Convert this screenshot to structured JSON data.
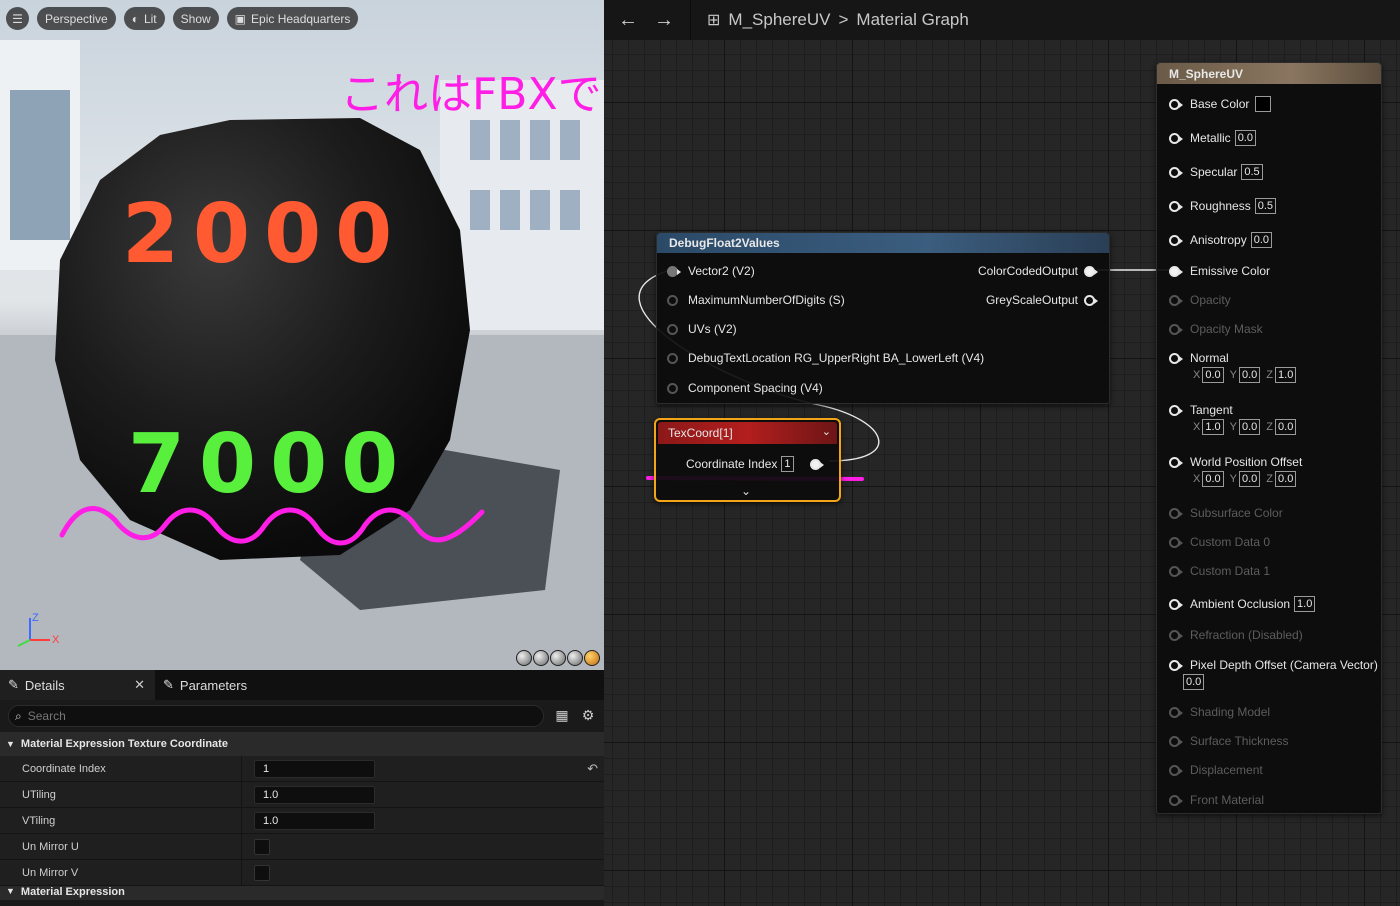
{
  "viewport": {
    "toolbar": {
      "menu_icon": "hamburger-icon",
      "perspective": "Perspective",
      "lit": "Lit",
      "show": "Show",
      "level": "Epic Headquarters"
    },
    "overlay_text": "これはFBXで書き出したモデル",
    "overlay_color": "#ff1ee6",
    "sphere_top_text": "2000",
    "sphere_top_color": "#ff5a32",
    "sphere_bottom_text": "7000",
    "sphere_bottom_color": "#58f03c",
    "axis_z": "Z",
    "axis_x": "X"
  },
  "details": {
    "tabs": [
      {
        "label": "Details",
        "icon": "pencil-icon"
      },
      {
        "label": "Parameters",
        "icon": "pencil-icon"
      }
    ],
    "search_placeholder": "Search",
    "category": "Material Expression Texture Coordinate",
    "properties": [
      {
        "name": "Coordinate Index",
        "value": "1"
      },
      {
        "name": "UTiling",
        "value": "1.0"
      },
      {
        "name": "VTiling",
        "value": "1.0"
      },
      {
        "name": "Un Mirror U",
        "value": ""
      },
      {
        "name": "Un Mirror V",
        "value": ""
      }
    ],
    "next_category": "Material Expression"
  },
  "graph": {
    "header": {
      "back_icon": "arrow-left-icon",
      "forward_icon": "arrow-right-icon",
      "asset": "M_SphereUV",
      "separator": ">",
      "page": "Material Graph"
    },
    "debug_node": {
      "title": "DebugFloat2Values",
      "inputs": [
        "Vector2 (V2)",
        "MaximumNumberOfDigits (S)",
        "UVs (V2)",
        "DebugTextLocation RG_UpperRight BA_LowerLeft (V4)",
        "Component Spacing (V4)"
      ],
      "outputs": [
        "ColorCodedOutput",
        "GreyScaleOutput"
      ]
    },
    "texcoord_node": {
      "title": "TexCoord[1]",
      "label": "Coordinate Index",
      "index": "1"
    },
    "material_node": {
      "title": "M_SphereUV",
      "pins": [
        {
          "label": "Base Color",
          "type": "color",
          "enabled": true
        },
        {
          "label": "Metallic",
          "value": "0.0",
          "enabled": true
        },
        {
          "label": "Specular",
          "value": "0.5",
          "enabled": true
        },
        {
          "label": "Roughness",
          "value": "0.5",
          "enabled": true
        },
        {
          "label": "Anisotropy",
          "value": "0.0",
          "enabled": true
        },
        {
          "label": "Emissive Color",
          "enabled": true,
          "connected": true
        },
        {
          "label": "Opacity",
          "enabled": false
        },
        {
          "label": "Opacity Mask",
          "enabled": false
        },
        {
          "label": "Normal",
          "enabled": true,
          "x": "0.0",
          "y": "0.0",
          "z": "1.0"
        },
        {
          "label": "Tangent",
          "enabled": true,
          "x": "1.0",
          "y": "0.0",
          "z": "0.0"
        },
        {
          "label": "World Position Offset",
          "enabled": true,
          "x": "0.0",
          "y": "0.0",
          "z": "0.0"
        },
        {
          "label": "Subsurface Color",
          "enabled": false
        },
        {
          "label": "Custom Data 0",
          "enabled": false
        },
        {
          "label": "Custom Data 1",
          "enabled": false
        },
        {
          "label": "Ambient Occlusion",
          "value": "1.0",
          "enabled": true
        },
        {
          "label": "Refraction (Disabled)",
          "enabled": false
        },
        {
          "label": "Pixel Depth Offset (Camera Vector)",
          "value": "0.0",
          "enabled": true
        },
        {
          "label": "Shading Model",
          "enabled": false
        },
        {
          "label": "Surface Thickness",
          "enabled": false
        },
        {
          "label": "Displacement",
          "enabled": false
        },
        {
          "label": "Front Material",
          "enabled": false
        }
      ],
      "axis_labels": {
        "x": "X",
        "y": "Y",
        "z": "Z"
      }
    },
    "highlight_color": "#ff1ee6"
  }
}
